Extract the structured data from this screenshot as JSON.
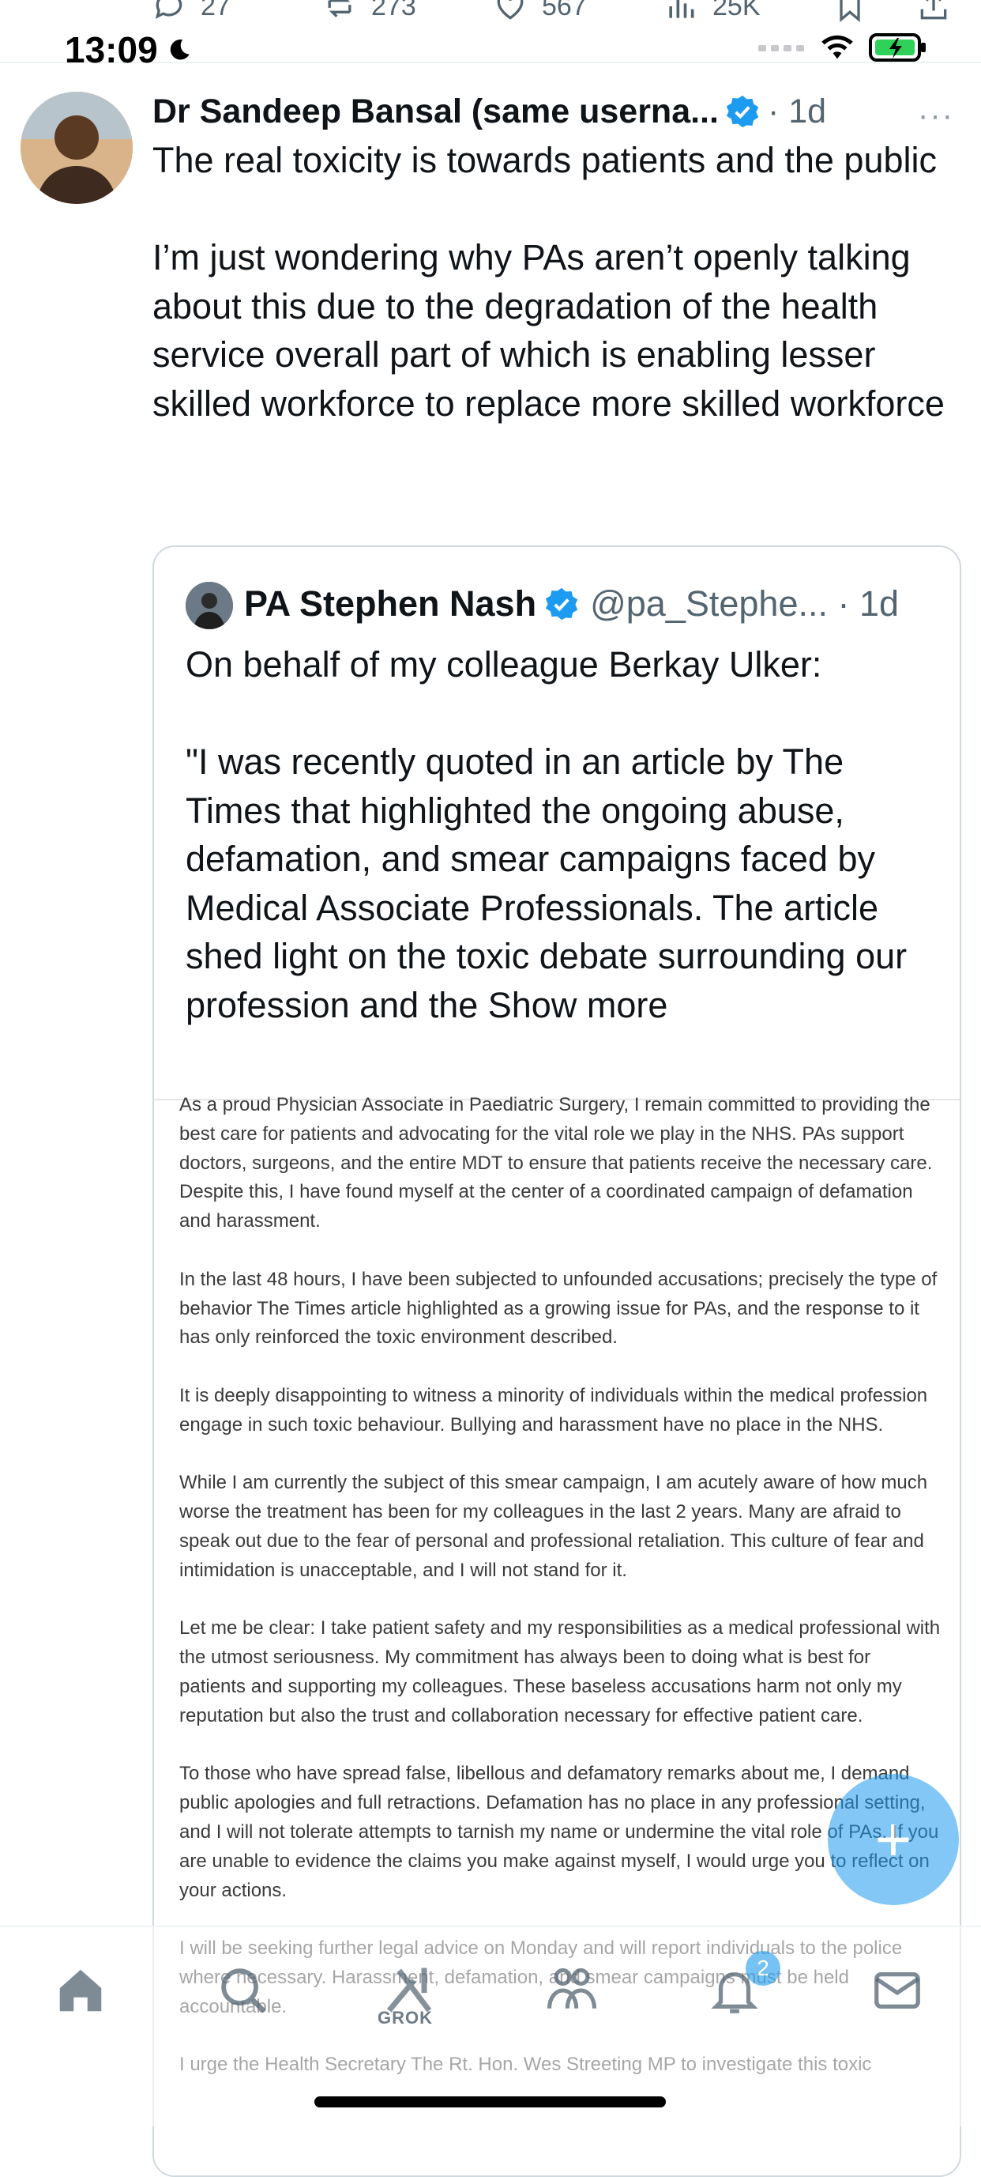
{
  "status_bar": {
    "time": "13:09"
  },
  "top_actions": {
    "replies": "27",
    "reposts": "273",
    "likes": "567",
    "views": "25K"
  },
  "tweet": {
    "author_name": "Dr Sandeep Bansal (same userna...",
    "time": "· 1d",
    "more": "···",
    "text": "The real toxicity is towards patients and the public\n\nI’m just wondering why PAs aren’t openly talking about this due to the degradation of the health service overall part of which is enabling lesser skilled workforce to replace more skilled workforce"
  },
  "quote": {
    "author_name": "PA Stephen Nash",
    "handle_time": "@pa_Stephe... · 1d",
    "text": "On behalf of my colleague Berkay Ulker:\n\n\"I was recently quoted in an article by The Times that highlighted the ongoing abuse, defamation, and smear campaigns faced by Medical Associate Professionals. The article shed light on the toxic debate surrounding our profession and the Show more",
    "image_text": "As a proud Physician Associate in Paediatric Surgery, I remain committed to providing the best care for patients and advocating for the vital role we play in the NHS. PAs support doctors, surgeons, and the entire MDT to ensure that patients receive the necessary care. Despite this, I have found myself at the center of a coordinated campaign of defamation and harassment.\n\nIn the last 48 hours, I have been subjected to unfounded accusations; precisely the type of behavior The Times article highlighted as a growing issue for PAs, and the response to it has only reinforced the toxic environment described.\n\nIt is deeply disappointing to witness a minority of individuals within the medical profession engage in such toxic behaviour. Bullying and harassment have no place in the NHS.\n\nWhile I am currently the subject of this smear campaign, I am acutely aware of how much worse the treatment has been for my colleagues in the last 2 years. Many are afraid to speak out due to the fear of personal and professional retaliation. This culture of fear and intimidation is unacceptable, and I will not stand for it.\n\nLet me be clear: I take patient safety and my responsibilities as a medical professional with the utmost seriousness. My commitment has always been to doing what is best for patients and supporting my colleagues. These baseless accusations harm not only my reputation but also the trust and collaboration necessary for effective patient care.\n\nTo those who have spread false, libellous and defamatory remarks about me, I demand public apologies and full retractions. Defamation has no place in any professional setting, and I will not tolerate attempts to tarnish my name or undermine the vital role of PAs. If you are unable to evidence the claims you make against myself, I would urge you to reflect on your actions.\n\nI will be seeking further legal advice on Monday and will report individuals to the police where necessary. Harassment, defamation, and smear campaigns must be held accountable.\n\nI urge the Health Secretary The Rt. Hon. Wes Streeting MP to investigate this toxic"
  },
  "fab": {
    "label": "+"
  },
  "bottom_nav": {
    "grok_label": "GROK",
    "notification_count": "2"
  },
  "colors": {
    "accent": "#1d9bf0",
    "text": "#0f1419",
    "secondary": "#536471",
    "battery": "#30d158"
  },
  "icons": [
    "reply-icon",
    "repost-icon",
    "like-icon",
    "views-icon",
    "bookmark-icon",
    "share-icon",
    "moon-icon",
    "wifi-icon",
    "battery-icon",
    "verified-badge-icon",
    "home-icon",
    "search-icon",
    "grok-icon",
    "communities-icon",
    "notifications-icon",
    "messages-icon"
  ]
}
